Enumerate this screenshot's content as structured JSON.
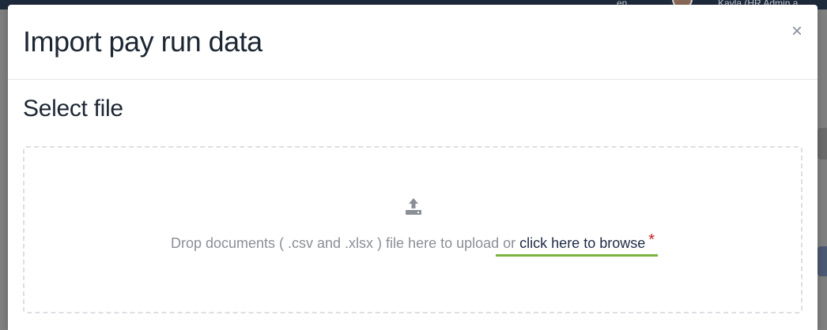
{
  "background": {
    "user_name": "Kayla (HR Admin a",
    "corner_label": "en"
  },
  "modal": {
    "title": "Import pay run data",
    "close_label": "×",
    "section_title": "Select file",
    "dropzone": {
      "icon": "upload-icon",
      "text": "Drop documents ( .csv and .xlsx ) file here to upload or",
      "browse_link": "click here to browse",
      "required": "*"
    }
  },
  "colors": {
    "accent_underline": "#7cb342",
    "required": "#c81c1c",
    "link": "#1d2b45"
  }
}
